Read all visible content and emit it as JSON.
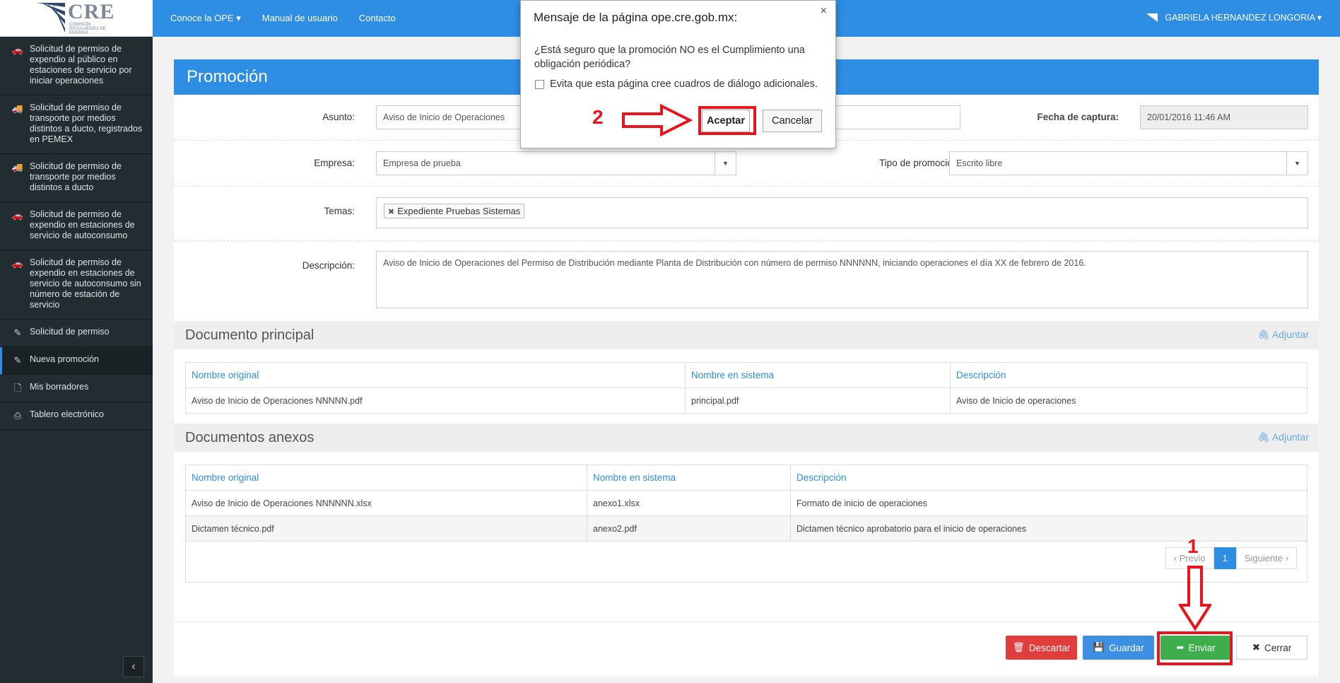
{
  "logo": {
    "name": "CRE",
    "subtitle": "Comisión Reguladora de Energía"
  },
  "topnav": {
    "items": [
      "Conoce la OPE ▾",
      "Manual de usuario",
      "Contacto"
    ]
  },
  "user": {
    "name": "GABRIELA HERNANDEZ LONGORIA ▾"
  },
  "sidebar": {
    "items": [
      {
        "label": "Solicitud de permiso de expendio al público en estaciones de servicio por iniciar operaciones",
        "icon": "car-icon"
      },
      {
        "label": "Solicitud de permiso de transporte por medios distintos a ducto, registrados en PEMEX",
        "icon": "truck-icon"
      },
      {
        "label": "Solicitud de permiso de transporte por medios distintos a ducto",
        "icon": "truck-icon"
      },
      {
        "label": "Solicitud de permiso de expendio en estaciones de servicio de autoconsumo",
        "icon": "car-icon"
      },
      {
        "label": "Solicitud de permiso de expendio en estaciones de servicio de autoconsumo sin número de estación de servicio",
        "icon": "car-icon"
      },
      {
        "label": "Solicitud de permiso",
        "icon": "pencil-icon"
      },
      {
        "label": "Nueva promoción",
        "icon": "pencil-icon"
      },
      {
        "label": "Mis borradores",
        "icon": "file-icon"
      },
      {
        "label": "Tablero electrónico",
        "icon": "inbox-icon"
      }
    ],
    "collapse": "‹"
  },
  "page": {
    "title": "Promoción"
  },
  "form": {
    "asunto_label": "Asunto:",
    "asunto_value": "Aviso de Inicio de Operaciones",
    "fecha_label": "Fecha de captura:",
    "fecha_value": "20/01/2016 11:46 AM",
    "empresa_label": "Empresa:",
    "empresa_value": "Empresa de prueba",
    "tipo_label": "Tipo de promoción:",
    "tipo_value": "Escrito libre",
    "temas_label": "Temas:",
    "temas_tag": "Expediente Pruebas Sistemas",
    "descripcion_label": "Descripción:",
    "descripcion_value": "Aviso de Inicio de Operaciones del Permiso de Distribución mediante Planta de Distribución  con número de permiso NNNNNN, iniciando operaciones el día XX de febrero de 2016."
  },
  "principal": {
    "title": "Documento principal",
    "attach": "Adjuntar",
    "headers": [
      "Nombre original",
      "Nombre en sistema",
      "Descripción"
    ],
    "rows": [
      [
        "Aviso de Inicio de Operaciones NNNNN.pdf",
        "principal.pdf",
        "Aviso de Inicio de operaciones"
      ]
    ]
  },
  "anexos": {
    "title": "Documentos anexos",
    "attach": "Adjuntar",
    "headers": [
      "Nombre original",
      "Nombre en sistema",
      "Descripción"
    ],
    "rows": [
      [
        "Aviso de Inicio de Operaciones NNNNNN.xlsx",
        "anexo1.xlsx",
        "Formato de inicio de operaciones"
      ],
      [
        "Dictamen técnico.pdf",
        "anexo2.pdf",
        "Dictamen técnico aprobatorio para el inicio de operaciones"
      ]
    ]
  },
  "pager": {
    "prev": "‹ Previo",
    "page": "1",
    "next": "Siguiente ›"
  },
  "actions": {
    "descartar": "Descartar",
    "guardar": "Guardar",
    "enviar": "Enviar",
    "cerrar": "Cerrar"
  },
  "colors": {
    "primary": "#2d8ee3",
    "danger": "#e13d3d",
    "success": "#3dae4b",
    "annotation": "#e8141e"
  },
  "dialog": {
    "title": "Mensaje de la página ope.cre.gob.mx:",
    "close": "×",
    "message": "¿Está seguro que la promoción NO es el Cumplimiento una obligación periódica?",
    "checkbox": "Evita que esta página cree cuadros de diálogo adicionales.",
    "accept": "Aceptar",
    "cancel": "Cancelar"
  },
  "annotations": {
    "step1": "1",
    "step2": "2"
  }
}
